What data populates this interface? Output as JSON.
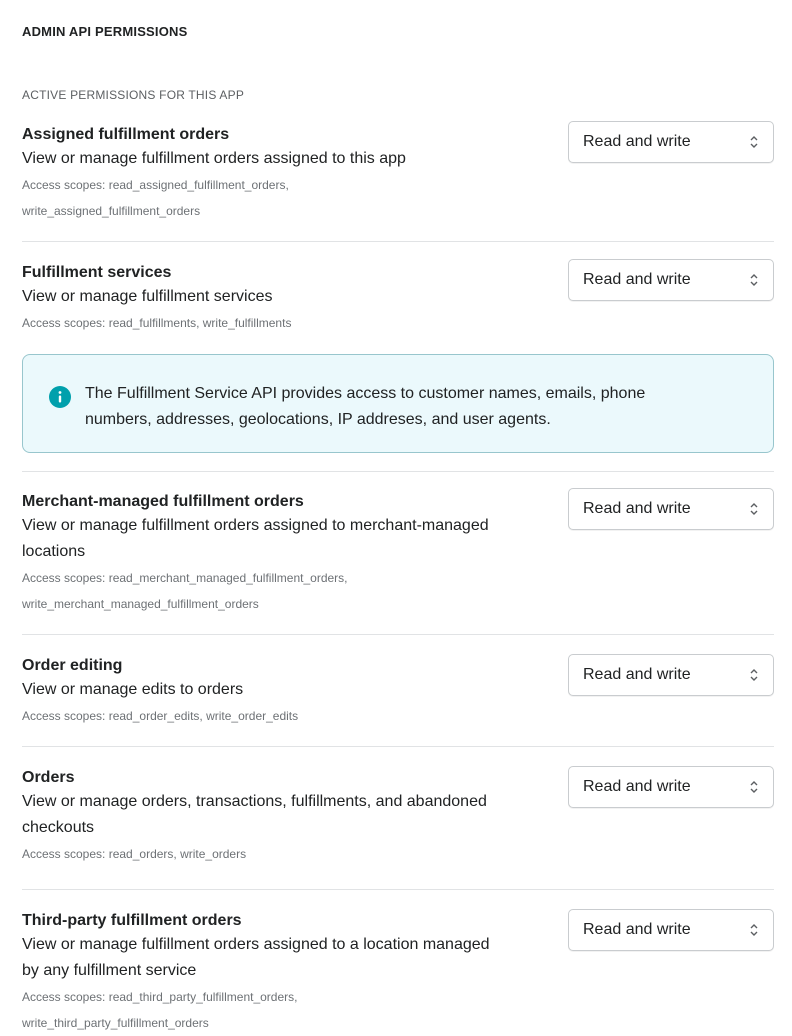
{
  "header": {
    "title": "ADMIN API PERMISSIONS",
    "subtitle": "ACTIVE PERMISSIONS FOR THIS APP"
  },
  "permissions": [
    {
      "name": "Assigned fulfillment orders",
      "description": "View or manage fulfillment orders assigned to this app",
      "scopes": "Access scopes: read_assigned_fulfillment_orders,\nwrite_assigned_fulfillment_orders",
      "access": "Read and write"
    },
    {
      "name": "Fulfillment services",
      "description": "View or manage fulfillment services",
      "scopes": "Access scopes: read_fulfillments, write_fulfillments",
      "access": "Read and write"
    },
    {
      "name": "Merchant-managed fulfillment orders",
      "description": "View or manage fulfillment orders assigned to merchant-managed\nlocations",
      "scopes": "Access scopes: read_merchant_managed_fulfillment_orders,\nwrite_merchant_managed_fulfillment_orders",
      "access": "Read and write"
    },
    {
      "name": "Order editing",
      "description": "View or manage edits to orders",
      "scopes": "Access scopes: read_order_edits, write_order_edits",
      "access": "Read and write"
    },
    {
      "name": "Orders",
      "description": "View or manage orders, transactions, fulfillments, and abandoned\ncheckouts",
      "scopes": "Access scopes: read_orders, write_orders",
      "access": "Read and write"
    },
    {
      "name": "Third-party fulfillment orders",
      "description": "View or manage fulfillment orders assigned to a location managed\nby any fulfillment service",
      "scopes": "Access scopes: read_third_party_fulfillment_orders,\nwrite_third_party_fulfillment_orders",
      "access": "Read and write"
    }
  ],
  "banner": {
    "text": "The Fulfillment Service API provides access to customer names, emails, phone\nnumbers, addresses, geolocations, IP addreses, and user agents.",
    "icon": "info-icon",
    "accent": "#00a0ac"
  }
}
